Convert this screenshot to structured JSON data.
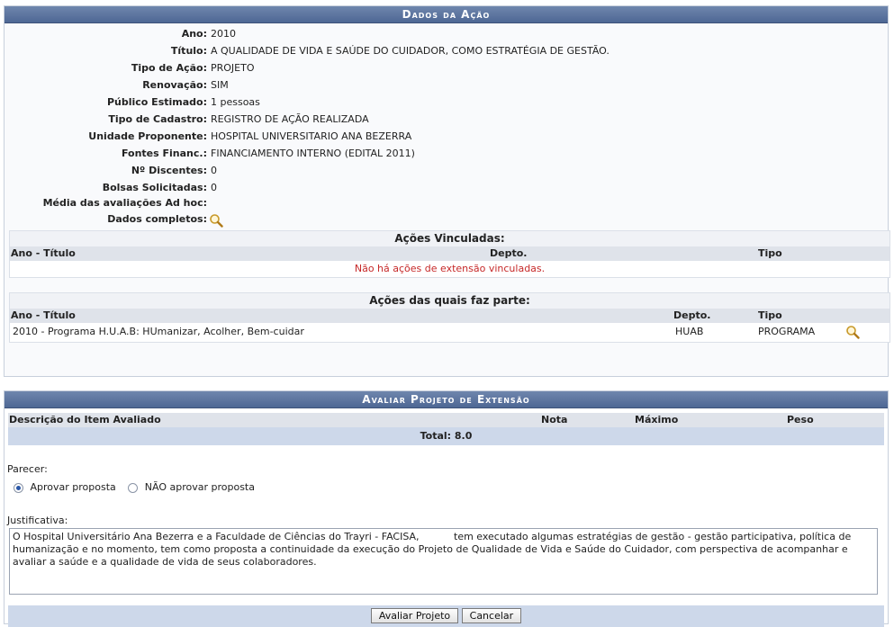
{
  "dados": {
    "header": "Dados da Ação",
    "fields": [
      {
        "label": "Ano:",
        "value": "2010"
      },
      {
        "label": "Título:",
        "value": "A QUALIDADE DE VIDA E SAÚDE DO CUIDADOR, COMO ESTRATÉGIA DE GESTÃO."
      },
      {
        "label": "Tipo de Ação:",
        "value": "PROJETO"
      },
      {
        "label": "Renovação:",
        "value": "SIM"
      },
      {
        "label": "Público Estimado:",
        "value": "1 pessoas"
      },
      {
        "label": "Tipo de Cadastro:",
        "value": "REGISTRO DE AÇÃO REALIZADA"
      },
      {
        "label": "Unidade Proponente:",
        "value": "HOSPITAL UNIVERSITARIO ANA BEZERRA"
      },
      {
        "label": "Fontes Financ.:",
        "value": "FINANCIAMENTO INTERNO (EDITAL 2011)"
      },
      {
        "label": "Nº Discentes:",
        "value": "0"
      },
      {
        "label": "Bolsas Solicitadas:",
        "value": "0"
      },
      {
        "label": "Média das avaliações Ad hoc:",
        "value": ""
      },
      {
        "label": "Dados completos:",
        "value": ""
      }
    ],
    "vinculadas": {
      "caption": "Ações Vinculadas:",
      "columns": [
        "Ano - Título",
        "Depto.",
        "Tipo"
      ],
      "empty_message": "Não há ações de extensão vinculadas."
    },
    "faz_parte": {
      "caption": "Ações das quais faz parte:",
      "columns": [
        "Ano - Título",
        "Depto.",
        "Tipo"
      ],
      "rows": [
        {
          "titulo": "2010 - Programa H.U.A.B: HUmanizar, Acolher, Bem-cuidar",
          "depto": "HUAB",
          "tipo": "PROGRAMA"
        }
      ]
    }
  },
  "avaliar": {
    "header": "Avaliar Projeto de Extensão",
    "columns": [
      "Descrição do Item Avaliado",
      "Nota",
      "Máximo",
      "Peso"
    ],
    "total": "Total: 8.0",
    "parecer_label": "Parecer:",
    "option_aprovar": "Aprovar proposta",
    "option_nao_aprovar": "NÃO aprovar proposta",
    "justificativa_label": "Justificativa:",
    "justificativa_text": "O Hospital Universitário Ana Bezerra e a Faculdade de Ciências do Trayri - FACISA,           tem executado algumas estratégias de gestão - gestão participativa, política de humanização e no momento, tem como proposta a continuidade da execução do Projeto de Qualidade de Vida e Saúde do Cuidador, com perspectiva de acompanhar e avaliar a saúde e a qualidade de vida de seus colaboradores.",
    "btn_avaliar": "Avaliar Projeto",
    "btn_cancelar": "Cancelar"
  },
  "icons": {
    "details": "magnifier-icon"
  }
}
